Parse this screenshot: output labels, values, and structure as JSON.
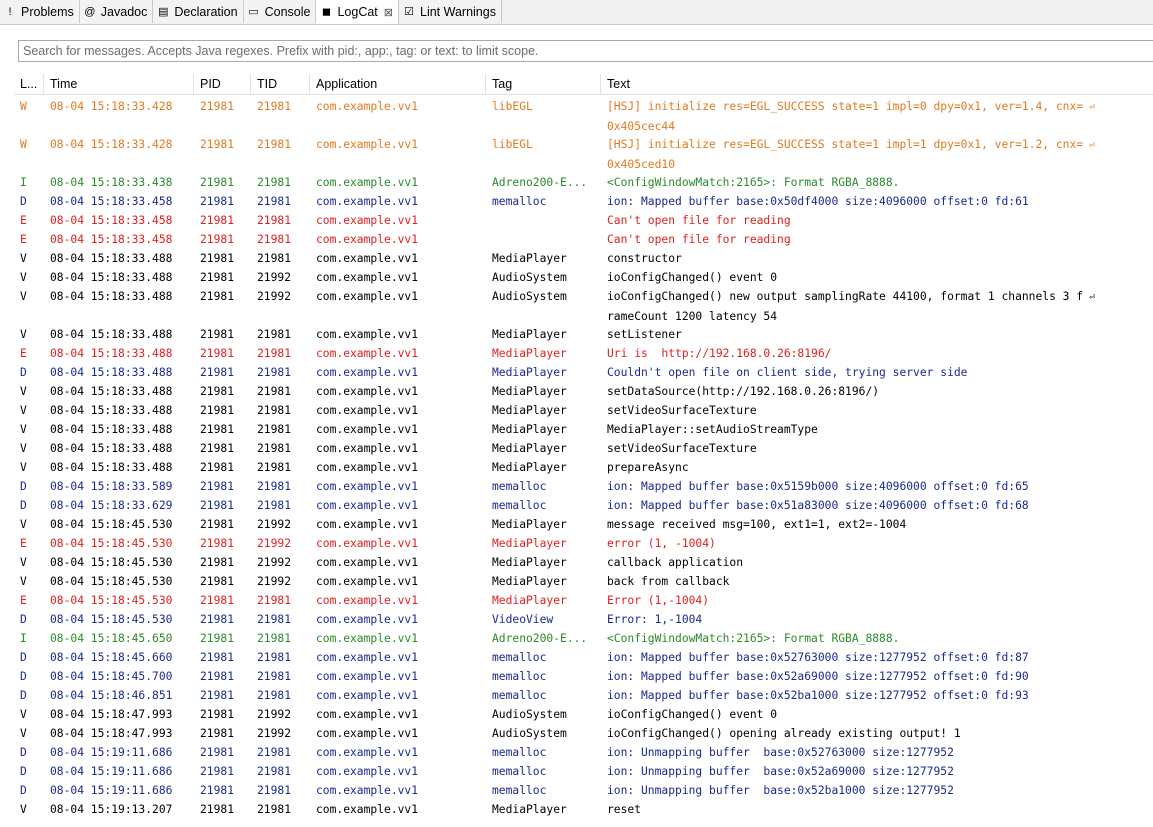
{
  "tabs": [
    {
      "label": "Problems",
      "icon": "problems-icon",
      "glyph": "!",
      "active": false
    },
    {
      "label": "Javadoc",
      "icon": "javadoc-icon",
      "glyph": "@",
      "active": false
    },
    {
      "label": "Declaration",
      "icon": "declaration-icon",
      "glyph": "▤",
      "active": false
    },
    {
      "label": "Console",
      "icon": "console-icon",
      "glyph": "▭",
      "active": false
    },
    {
      "label": "LogCat",
      "icon": "logcat-icon",
      "glyph": "◼",
      "active": true,
      "close": "⊠"
    },
    {
      "label": "Lint Warnings",
      "icon": "lint-warnings-icon",
      "glyph": "☑",
      "active": false
    }
  ],
  "search": {
    "placeholder": "Search for messages. Accepts Java regexes. Prefix with pid:, app:, tag: or text: to limit scope."
  },
  "columns": {
    "level": "L...",
    "time": "Time",
    "pid": "PID",
    "tid": "TID",
    "application": "Application",
    "tag": "Tag",
    "text": "Text"
  },
  "colors": {
    "W": "#e07a1f",
    "I": "#2a8a2a",
    "D": "#1a2a8c",
    "E": "#e02020",
    "V": "#000000"
  },
  "wrap_marker": "⏎",
  "rows": [
    {
      "level": "W",
      "time": "08-04 15:18:33.428",
      "pid": "21981",
      "tid": "21981",
      "app": "com.example.vv1",
      "tag": "libEGL",
      "text": "[HSJ] initialize res=EGL_SUCCESS state=1 impl=0 dpy=0x1, ver=1.4, cnx=",
      "text2": "0x405cec44"
    },
    {
      "level": "W",
      "time": "08-04 15:18:33.428",
      "pid": "21981",
      "tid": "21981",
      "app": "com.example.vv1",
      "tag": "libEGL",
      "text": "[HSJ] initialize res=EGL_SUCCESS state=1 impl=1 dpy=0x1, ver=1.2, cnx=",
      "text2": "0x405ced10"
    },
    {
      "level": "I",
      "time": "08-04 15:18:33.438",
      "pid": "21981",
      "tid": "21981",
      "app": "com.example.vv1",
      "tag": "Adreno200-E...",
      "text": "<ConfigWindowMatch:2165>: Format RGBA_8888."
    },
    {
      "level": "D",
      "time": "08-04 15:18:33.458",
      "pid": "21981",
      "tid": "21981",
      "app": "com.example.vv1",
      "tag": "memalloc",
      "text": "ion: Mapped buffer base:0x50df4000 size:4096000 offset:0 fd:61"
    },
    {
      "level": "E",
      "time": "08-04 15:18:33.458",
      "pid": "21981",
      "tid": "21981",
      "app": "com.example.vv1",
      "tag": "",
      "text": "Can't open file for reading"
    },
    {
      "level": "E",
      "time": "08-04 15:18:33.458",
      "pid": "21981",
      "tid": "21981",
      "app": "com.example.vv1",
      "tag": "",
      "text": "Can't open file for reading"
    },
    {
      "level": "V",
      "time": "08-04 15:18:33.488",
      "pid": "21981",
      "tid": "21981",
      "app": "com.example.vv1",
      "tag": "MediaPlayer",
      "text": "constructor"
    },
    {
      "level": "V",
      "time": "08-04 15:18:33.488",
      "pid": "21981",
      "tid": "21992",
      "app": "com.example.vv1",
      "tag": "AudioSystem",
      "text": "ioConfigChanged() event 0"
    },
    {
      "level": "V",
      "time": "08-04 15:18:33.488",
      "pid": "21981",
      "tid": "21992",
      "app": "com.example.vv1",
      "tag": "AudioSystem",
      "text": "ioConfigChanged() new output samplingRate 44100, format 1 channels 3 f",
      "text2": "rameCount 1200 latency 54"
    },
    {
      "level": "V",
      "time": "08-04 15:18:33.488",
      "pid": "21981",
      "tid": "21981",
      "app": "com.example.vv1",
      "tag": "MediaPlayer",
      "text": "setListener"
    },
    {
      "level": "E",
      "time": "08-04 15:18:33.488",
      "pid": "21981",
      "tid": "21981",
      "app": "com.example.vv1",
      "tag": "MediaPlayer",
      "text": "Uri is  http://192.168.0.26:8196/"
    },
    {
      "level": "D",
      "time": "08-04 15:18:33.488",
      "pid": "21981",
      "tid": "21981",
      "app": "com.example.vv1",
      "tag": "MediaPlayer",
      "text": "Couldn't open file on client side, trying server side"
    },
    {
      "level": "V",
      "time": "08-04 15:18:33.488",
      "pid": "21981",
      "tid": "21981",
      "app": "com.example.vv1",
      "tag": "MediaPlayer",
      "text": "setDataSource(http://192.168.0.26:8196/)"
    },
    {
      "level": "V",
      "time": "08-04 15:18:33.488",
      "pid": "21981",
      "tid": "21981",
      "app": "com.example.vv1",
      "tag": "MediaPlayer",
      "text": "setVideoSurfaceTexture"
    },
    {
      "level": "V",
      "time": "08-04 15:18:33.488",
      "pid": "21981",
      "tid": "21981",
      "app": "com.example.vv1",
      "tag": "MediaPlayer",
      "text": "MediaPlayer::setAudioStreamType"
    },
    {
      "level": "V",
      "time": "08-04 15:18:33.488",
      "pid": "21981",
      "tid": "21981",
      "app": "com.example.vv1",
      "tag": "MediaPlayer",
      "text": "setVideoSurfaceTexture"
    },
    {
      "level": "V",
      "time": "08-04 15:18:33.488",
      "pid": "21981",
      "tid": "21981",
      "app": "com.example.vv1",
      "tag": "MediaPlayer",
      "text": "prepareAsync"
    },
    {
      "level": "D",
      "time": "08-04 15:18:33.589",
      "pid": "21981",
      "tid": "21981",
      "app": "com.example.vv1",
      "tag": "memalloc",
      "text": "ion: Mapped buffer base:0x5159b000 size:4096000 offset:0 fd:65"
    },
    {
      "level": "D",
      "time": "08-04 15:18:33.629",
      "pid": "21981",
      "tid": "21981",
      "app": "com.example.vv1",
      "tag": "memalloc",
      "text": "ion: Mapped buffer base:0x51a83000 size:4096000 offset:0 fd:68"
    },
    {
      "level": "V",
      "time": "08-04 15:18:45.530",
      "pid": "21981",
      "tid": "21992",
      "app": "com.example.vv1",
      "tag": "MediaPlayer",
      "text": "message received msg=100, ext1=1, ext2=-1004"
    },
    {
      "level": "E",
      "time": "08-04 15:18:45.530",
      "pid": "21981",
      "tid": "21992",
      "app": "com.example.vv1",
      "tag": "MediaPlayer",
      "text": "error (1, -1004)"
    },
    {
      "level": "V",
      "time": "08-04 15:18:45.530",
      "pid": "21981",
      "tid": "21992",
      "app": "com.example.vv1",
      "tag": "MediaPlayer",
      "text": "callback application"
    },
    {
      "level": "V",
      "time": "08-04 15:18:45.530",
      "pid": "21981",
      "tid": "21992",
      "app": "com.example.vv1",
      "tag": "MediaPlayer",
      "text": "back from callback"
    },
    {
      "level": "E",
      "time": "08-04 15:18:45.530",
      "pid": "21981",
      "tid": "21981",
      "app": "com.example.vv1",
      "tag": "MediaPlayer",
      "text": "Error (1,-1004)"
    },
    {
      "level": "D",
      "time": "08-04 15:18:45.530",
      "pid": "21981",
      "tid": "21981",
      "app": "com.example.vv1",
      "tag": "VideoView",
      "text": "Error: 1,-1004"
    },
    {
      "level": "I",
      "time": "08-04 15:18:45.650",
      "pid": "21981",
      "tid": "21981",
      "app": "com.example.vv1",
      "tag": "Adreno200-E...",
      "text": "<ConfigWindowMatch:2165>: Format RGBA_8888."
    },
    {
      "level": "D",
      "time": "08-04 15:18:45.660",
      "pid": "21981",
      "tid": "21981",
      "app": "com.example.vv1",
      "tag": "memalloc",
      "text": "ion: Mapped buffer base:0x52763000 size:1277952 offset:0 fd:87"
    },
    {
      "level": "D",
      "time": "08-04 15:18:45.700",
      "pid": "21981",
      "tid": "21981",
      "app": "com.example.vv1",
      "tag": "memalloc",
      "text": "ion: Mapped buffer base:0x52a69000 size:1277952 offset:0 fd:90"
    },
    {
      "level": "D",
      "time": "08-04 15:18:46.851",
      "pid": "21981",
      "tid": "21981",
      "app": "com.example.vv1",
      "tag": "memalloc",
      "text": "ion: Mapped buffer base:0x52ba1000 size:1277952 offset:0 fd:93"
    },
    {
      "level": "V",
      "time": "08-04 15:18:47.993",
      "pid": "21981",
      "tid": "21992",
      "app": "com.example.vv1",
      "tag": "AudioSystem",
      "text": "ioConfigChanged() event 0"
    },
    {
      "level": "V",
      "time": "08-04 15:18:47.993",
      "pid": "21981",
      "tid": "21992",
      "app": "com.example.vv1",
      "tag": "AudioSystem",
      "text": "ioConfigChanged() opening already existing output! 1"
    },
    {
      "level": "D",
      "time": "08-04 15:19:11.686",
      "pid": "21981",
      "tid": "21981",
      "app": "com.example.vv1",
      "tag": "memalloc",
      "text": "ion: Unmapping buffer  base:0x52763000 size:1277952"
    },
    {
      "level": "D",
      "time": "08-04 15:19:11.686",
      "pid": "21981",
      "tid": "21981",
      "app": "com.example.vv1",
      "tag": "memalloc",
      "text": "ion: Unmapping buffer  base:0x52a69000 size:1277952"
    },
    {
      "level": "D",
      "time": "08-04 15:19:11.686",
      "pid": "21981",
      "tid": "21981",
      "app": "com.example.vv1",
      "tag": "memalloc",
      "text": "ion: Unmapping buffer  base:0x52ba1000 size:1277952"
    },
    {
      "level": "V",
      "time": "08-04 15:19:13.207",
      "pid": "21981",
      "tid": "21981",
      "app": "com.example.vv1",
      "tag": "MediaPlayer",
      "text": "reset"
    }
  ]
}
